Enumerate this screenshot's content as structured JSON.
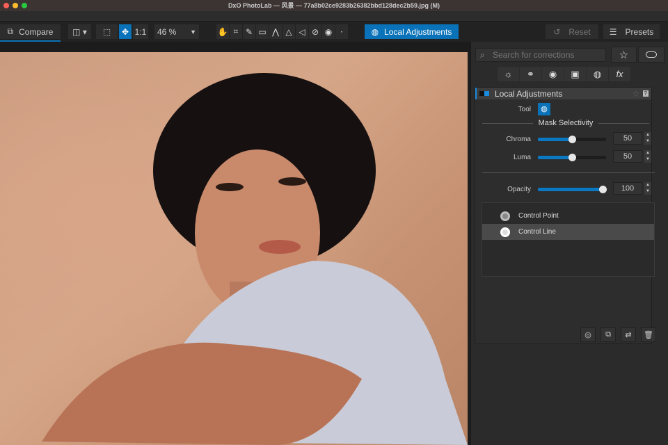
{
  "window": {
    "title": "DxO PhotoLab — 风景 — 77a8b02ce9283b26382bbd128dec2b59.jpg (M)"
  },
  "toolbar": {
    "compare": "Compare",
    "one_to_one": "1:1",
    "zoom": "46 %",
    "local_adjustments": "Local Adjustments",
    "reset": "Reset",
    "presets": "Presets"
  },
  "panel": {
    "search_placeholder": "Search for corrections",
    "section_title": "Local Adjustments",
    "tool_label": "Tool",
    "mask_selectivity": "Mask Selectivity",
    "chroma": {
      "label": "Chroma",
      "value": "50",
      "fraction": 0.5
    },
    "luma": {
      "label": "Luma",
      "value": "50",
      "fraction": 0.5
    },
    "opacity": {
      "label": "Opacity",
      "value": "100",
      "fraction": 1.0
    },
    "items": [
      "Control Point",
      "Control Line"
    ],
    "selected_item": "Control Line"
  },
  "colors": {
    "accent": "#0a72b8"
  }
}
